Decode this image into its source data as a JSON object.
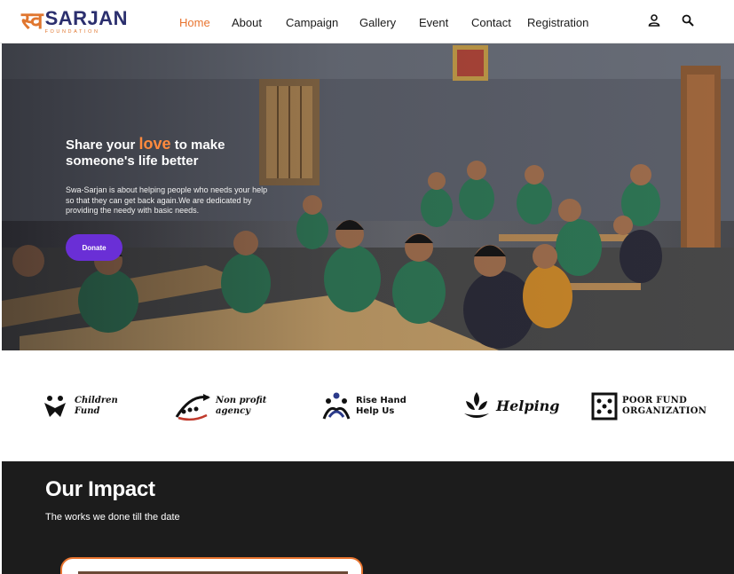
{
  "logo": {
    "mark": "स्व",
    "name": "SARJAN",
    "sub": "FOUNDATION"
  },
  "nav": {
    "items": [
      {
        "label": "Home",
        "active": true
      },
      {
        "label": "About"
      },
      {
        "label": "Campaign"
      },
      {
        "label": "Gallery"
      },
      {
        "label": "Event"
      },
      {
        "label": "Contact"
      },
      {
        "label": "Registration"
      }
    ],
    "icons": [
      "user-icon",
      "search-icon"
    ]
  },
  "hero": {
    "title_pre": "Share your ",
    "title_love": "love",
    "title_post": " to make someone's life better",
    "description": "Swa-Sarjan is about helping people who needs your help so that they can get back again.We are dedicated by providing the needy with basic needs.",
    "donate_label": "Donate"
  },
  "partners": [
    {
      "line1": "Children",
      "line2": "Fund",
      "icon": "children-fund-logo"
    },
    {
      "line1": "Non profit",
      "line2": "agency",
      "icon": "nonprofit-agency-logo"
    },
    {
      "line1": "Rise Hand",
      "line2": "Help Us",
      "icon": "rise-hand-logo"
    },
    {
      "line1": "Helping",
      "line2": "",
      "icon": "helping-logo"
    },
    {
      "line1": "POOR FUND",
      "line2": "ORGANIZATION",
      "icon": "poor-fund-logo"
    }
  ],
  "impact": {
    "title": "Our Impact",
    "subtitle": "The works we done till the date"
  },
  "colors": {
    "accent": "#e8742f",
    "brand": "#2b2f6e",
    "button": "#6a2fd6",
    "impact_bg": "#1c1c1c"
  }
}
